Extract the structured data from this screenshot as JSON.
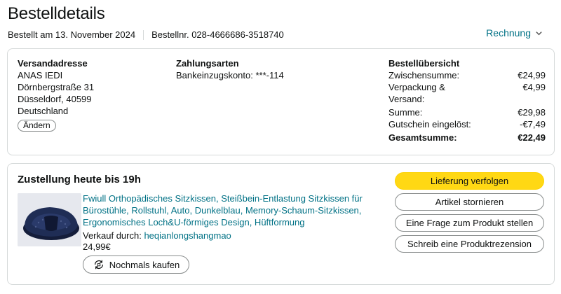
{
  "header": {
    "title": "Bestelldetails",
    "ordered_on": "Bestellt am 13. November 2024",
    "order_number": "Bestellnr. 028-4666686-3518740",
    "invoice_label": "Rechnung"
  },
  "shipping": {
    "heading": "Versandadresse",
    "lines": [
      "ANAS IEDI",
      "Dörnbergstraße 31",
      "Düsseldorf, 40599",
      "Deutschland"
    ],
    "change_label": "Ändern"
  },
  "payment": {
    "heading": "Zahlungsarten",
    "method": "Bankeinzugskonto: ***-114"
  },
  "summary": {
    "heading": "Bestellübersicht",
    "rows": [
      {
        "label": "Zwischensumme:",
        "value": "€24,99"
      },
      {
        "label": "Verpackung & Versand:",
        "value": "€4,99"
      },
      {
        "label": "Summe:",
        "value": "€29,98"
      },
      {
        "label": "Gutschein eingelöst:",
        "value": "-€7,49"
      }
    ],
    "total": {
      "label": "Gesamtsumme:",
      "value": "€22,49"
    }
  },
  "delivery": {
    "heading": "Zustellung heute bis 19h",
    "product_title": "Fwiull Orthopädisches Sitzkissen, Steißbein-Entlastung Sitzkissen für Bürostühle, Rollstuhl, Auto, Dunkelblau, Memory-Schaum-Sitzkissen, Ergonomisches Loch&U-förmiges Design, Hüftformung",
    "seller_prefix": "Verkauf durch:",
    "seller_name": "heqianlongshangmao",
    "price": "24,99€",
    "buy_again_label": "Nochmals kaufen"
  },
  "actions": {
    "track": "Lieferung verfolgen",
    "cancel": "Artikel stornieren",
    "question": "Eine Frage zum Produkt stellen",
    "review": "Schreib eine Produktrezension"
  },
  "colors": {
    "link": "#007185",
    "primary_button": "#ffd814",
    "border": "#d5d9d9",
    "product_navy": "#1f2d55"
  }
}
